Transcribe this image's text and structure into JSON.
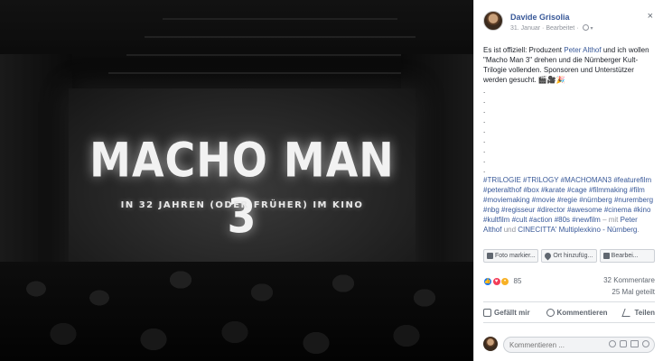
{
  "photo": {
    "title_text": "MACHO MAN 3",
    "subtitle_text": "IN 32 JAHREN (ODER FRÜHER) IM KINO"
  },
  "post": {
    "author": "Davide Grisolia",
    "date": "31. Januar",
    "edited": "Bearbeitet",
    "separator": "·",
    "close_symbol": "×",
    "text_1": "Es ist offiziell: Produzent ",
    "producer": "Peter Althof",
    "text_2": " und ich wollen \"Macho Man 3\" drehen und die Nürnberger Kult-Trilogie vollenden. Sponsoren und Unterstützer werden gesucht. 🎬🎥🎉",
    "dots": [
      ".",
      ".",
      ".",
      ".",
      ".",
      ".",
      ".",
      ".",
      "."
    ],
    "hashtags": "#TRILOGIE #TRILOGY #MACHOMAN3 #featurefilm #peteralthof #box #karate #cage #filmmaking #film #moviemaking #movie #regie #nürnberg #nuremberg #nbg #regisseur #director #awesome #cinema #kino #kultfilm #cult #action #80s #newfilm",
    "with_text": " – mit ",
    "with_person": "Peter Althof",
    "and_text": " und ",
    "location": "CINECITTA' Multiplexkino - Nürnberg",
    "period": "."
  },
  "tag_buttons": [
    {
      "label": "Foto markier...",
      "icon": "tag-icon"
    },
    {
      "label": "Ort hinzufüg...",
      "icon": "location-pin-icon"
    },
    {
      "label": "Bearbei...",
      "icon": "pencil-icon"
    }
  ],
  "stats": {
    "reaction_count": "85",
    "comments": "32 Kommentare",
    "shares": "25 Mal geteilt"
  },
  "actions": {
    "like": "Gefällt mir",
    "comment": "Kommentieren",
    "share": "Teilen"
  },
  "comment_box": {
    "placeholder": "Kommentieren ..."
  }
}
